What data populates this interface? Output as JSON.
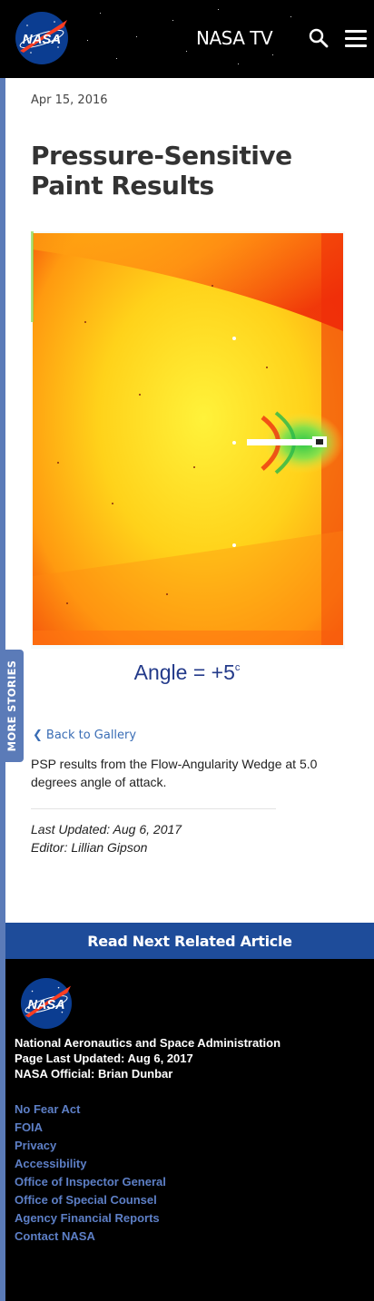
{
  "header": {
    "logo_text": "NASA",
    "nav_title": "NASA TV"
  },
  "sidebar": {
    "more_stories_label": "MORE STORIES"
  },
  "article": {
    "date": "Apr 15, 2016",
    "title": "Pressure-Sensitive Paint Results",
    "figure_caption_text": "Angle  =  +5",
    "figure_caption_sup": "c",
    "back_label": "Back to Gallery",
    "description": "PSP results from the Flow-Angularity Wedge at 5.0 degrees angle of attack.",
    "last_updated": "Last Updated: Aug 6, 2017",
    "editor": "Editor: Lillian Gipson"
  },
  "related": {
    "label": "Read Next Related Article"
  },
  "footer": {
    "logo_text": "NASA",
    "org": "National Aeronautics and Space Administration",
    "page_updated": "Page Last Updated: Aug 6, 2017",
    "official": "NASA Official: Brian Dunbar",
    "links": [
      "No Fear Act",
      "FOIA",
      "Privacy",
      "Accessibility",
      "Office of Inspector General",
      "Office of Special Counsel",
      "Agency Financial Reports",
      "Contact NASA"
    ]
  },
  "colors": {
    "accent_blue": "#1e4c9a",
    "rail_blue": "#5b7bb8",
    "link_blue": "#5d7fc6"
  }
}
